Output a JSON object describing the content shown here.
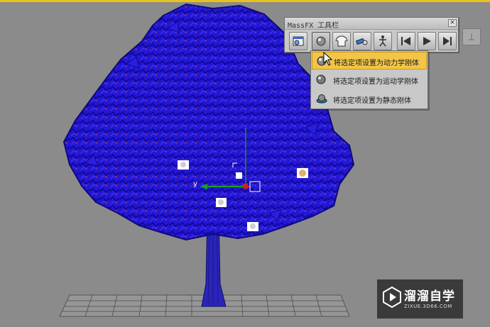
{
  "toolbar": {
    "title": "MassFX 工具栏",
    "close_label": "×",
    "buttons": [
      {
        "name": "world-parameters",
        "icon": "world-params-icon"
      },
      {
        "name": "rigid-body",
        "icon": "sphere-icon"
      },
      {
        "name": "cloth",
        "icon": "tshirt-icon"
      },
      {
        "name": "constraint",
        "icon": "constraint-icon"
      },
      {
        "name": "ragdoll",
        "icon": "ragdoll-icon"
      },
      {
        "name": "reset-simulation",
        "icon": "reset-simulation-icon"
      },
      {
        "name": "play-simulation",
        "icon": "play-simulation-icon"
      },
      {
        "name": "step-simulation",
        "icon": "step-simulation-icon"
      }
    ]
  },
  "menu": {
    "items": [
      {
        "label": "将选定项设置为动力学刚体",
        "icon": "dynamic-rigid-body-icon",
        "highlighted": true
      },
      {
        "label": "将选定项设置为运动学刚体",
        "icon": "kinematic-rigid-body-icon",
        "highlighted": false
      },
      {
        "label": "将选定项设置为静态刚体",
        "icon": "static-rigid-body-icon",
        "highlighted": false
      }
    ]
  },
  "gizmo": {
    "axis_label": "y"
  },
  "watermark": {
    "name": "溜溜自学",
    "url": "ZIXUE.3D66.COM"
  },
  "colors": {
    "viewport_bg": "#8b8b8b",
    "tree_foliage": "#1e14d8",
    "selection_highlight": "#f2c548",
    "viewport_border": "#e8c21a"
  }
}
